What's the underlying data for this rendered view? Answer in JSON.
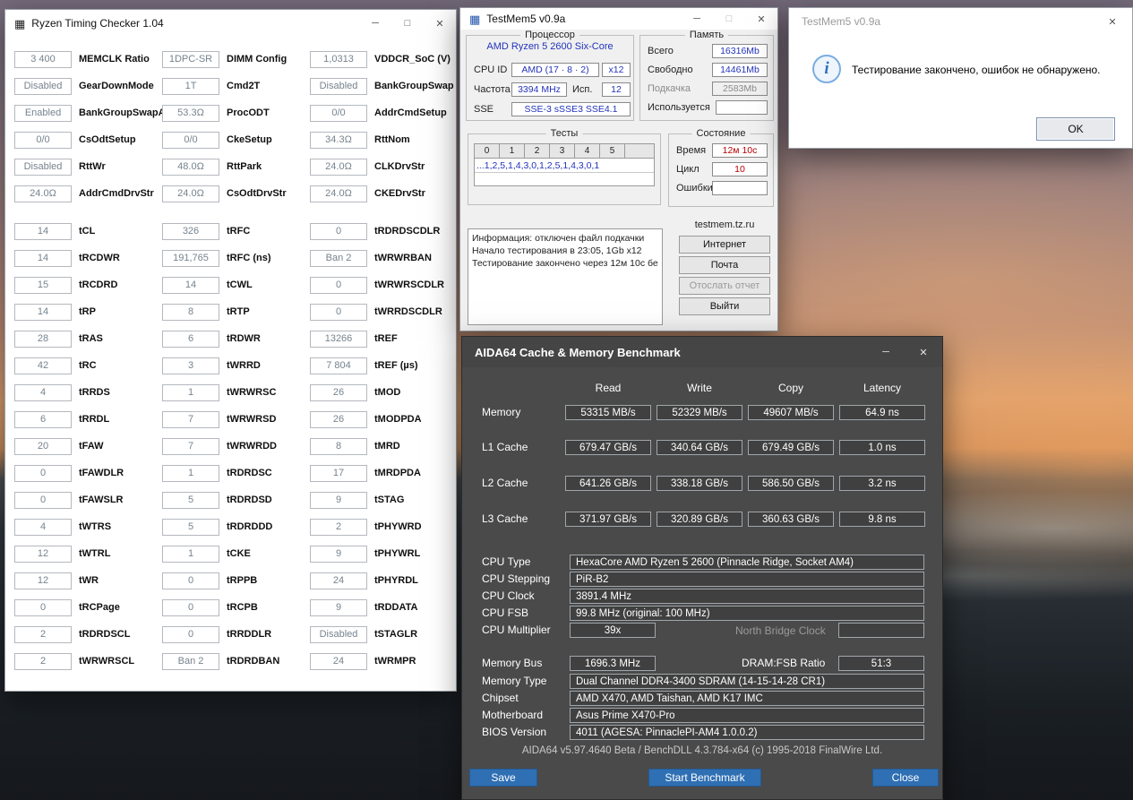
{
  "colors": {
    "rtc_value_text": "#76838e",
    "tm5_value_blue": "#2233bb",
    "tm5_alert_red": "#bb0000",
    "aida_window_bg": "#4a4a4a",
    "aida_button_blue": "#2f6fb3"
  },
  "window_controls": {
    "minimize": "─",
    "maximize": "□",
    "close": "✕"
  },
  "rtc": {
    "title": "Ryzen Timing Checker 1.04",
    "top": [
      {
        "v": "3 400",
        "l": "MEMCLK Ratio"
      },
      {
        "v": "1DPC-SR",
        "l": "DIMM Config"
      },
      {
        "v": "1,0313",
        "l": "VDDCR_SoC (V)"
      },
      {
        "v": "Disabled",
        "l": "GearDownMode"
      },
      {
        "v": "1T",
        "l": "Cmd2T"
      },
      {
        "v": "Disabled",
        "l": "BankGroupSwap"
      },
      {
        "v": "Enabled",
        "l": "BankGroupSwapAlt"
      },
      {
        "v": "53.3Ω",
        "l": "ProcODT"
      },
      {
        "v": "0/0",
        "l": "AddrCmdSetup"
      },
      {
        "v": "0/0",
        "l": "CsOdtSetup"
      },
      {
        "v": "0/0",
        "l": "CkeSetup"
      },
      {
        "v": "34.3Ω",
        "l": "RttNom"
      },
      {
        "v": "Disabled",
        "l": "RttWr"
      },
      {
        "v": "48.0Ω",
        "l": "RttPark"
      },
      {
        "v": "24.0Ω",
        "l": "CLKDrvStr"
      },
      {
        "v": "24.0Ω",
        "l": "AddrCmdDrvStr"
      },
      {
        "v": "24.0Ω",
        "l": "CsOdtDrvStr"
      },
      {
        "v": "24.0Ω",
        "l": "CKEDrvStr"
      }
    ],
    "main": [
      {
        "v": "14",
        "l": "tCL"
      },
      {
        "v": "326",
        "l": "tRFC"
      },
      {
        "v": "0",
        "l": "tRDRDSCDLR"
      },
      {
        "v": "14",
        "l": "tRCDWR"
      },
      {
        "v": "191,765",
        "l": "tRFC (ns)"
      },
      {
        "v": "Ban 2",
        "l": "tWRWRBAN"
      },
      {
        "v": "15",
        "l": "tRCDRD"
      },
      {
        "v": "14",
        "l": "tCWL"
      },
      {
        "v": "0",
        "l": "tWRWRSCDLR"
      },
      {
        "v": "14",
        "l": "tRP"
      },
      {
        "v": "8",
        "l": "tRTP"
      },
      {
        "v": "0",
        "l": "tWRRDSCDLR"
      },
      {
        "v": "28",
        "l": "tRAS"
      },
      {
        "v": "6",
        "l": "tRDWR"
      },
      {
        "v": "13266",
        "l": "tREF"
      },
      {
        "v": "42",
        "l": "tRC"
      },
      {
        "v": "3",
        "l": "tWRRD"
      },
      {
        "v": "7 804",
        "l": "tREF (µs)"
      },
      {
        "v": "4",
        "l": "tRRDS"
      },
      {
        "v": "1",
        "l": "tWRWRSC"
      },
      {
        "v": "26",
        "l": "tMOD"
      },
      {
        "v": "6",
        "l": "tRRDL"
      },
      {
        "v": "7",
        "l": "tWRWRSD"
      },
      {
        "v": "26",
        "l": "tMODPDA"
      },
      {
        "v": "20",
        "l": "tFAW"
      },
      {
        "v": "7",
        "l": "tWRWRDD"
      },
      {
        "v": "8",
        "l": "tMRD"
      },
      {
        "v": "0",
        "l": "tFAWDLR"
      },
      {
        "v": "1",
        "l": "tRDRDSC"
      },
      {
        "v": "17",
        "l": "tMRDPDA"
      },
      {
        "v": "0",
        "l": "tFAWSLR"
      },
      {
        "v": "5",
        "l": "tRDRDSD"
      },
      {
        "v": "9",
        "l": "tSTAG"
      },
      {
        "v": "4",
        "l": "tWTRS"
      },
      {
        "v": "5",
        "l": "tRDRDDD"
      },
      {
        "v": "2",
        "l": "tPHYWRD"
      },
      {
        "v": "12",
        "l": "tWTRL"
      },
      {
        "v": "1",
        "l": "tCKE"
      },
      {
        "v": "9",
        "l": "tPHYWRL"
      },
      {
        "v": "12",
        "l": "tWR"
      },
      {
        "v": "0",
        "l": "tRPPB"
      },
      {
        "v": "24",
        "l": "tPHYRDL"
      },
      {
        "v": "0",
        "l": "tRCPage"
      },
      {
        "v": "0",
        "l": "tRCPB"
      },
      {
        "v": "9",
        "l": "tRDDATA"
      },
      {
        "v": "2",
        "l": "tRDRDSCL"
      },
      {
        "v": "0",
        "l": "tRRDDLR"
      },
      {
        "v": "Disabled",
        "l": "tSTAGLR"
      },
      {
        "v": "2",
        "l": "tWRWRSCL"
      },
      {
        "v": "Ban 2",
        "l": "tRDRDBAN"
      },
      {
        "v": "24",
        "l": "tWRMPR"
      }
    ]
  },
  "tm5": {
    "title": "TestMem5 v0.9a",
    "cpu": {
      "caption": "Процессор",
      "name": "AMD Ryzen 5 2600 Six-Core",
      "cpuid_label": "CPU ID",
      "cpuid_value": "AMD  (17 · 8 · 2)",
      "cpuid_x": "x12",
      "freq_label": "Частота",
      "freq_value": "3394 MHz",
      "usage_label": "Исп.",
      "usage_value": "12",
      "sse_label": "SSE",
      "sse_value": "SSE-3 sSSE3 SSE4.1"
    },
    "memory": {
      "caption": "Память",
      "rows": [
        {
          "label": "Всего",
          "value": "16316Mb"
        },
        {
          "label": "Свободно",
          "value": "14461Mb"
        },
        {
          "label": "Подкачка",
          "value": "2583Mb"
        },
        {
          "label": "Используется",
          "value": ""
        }
      ]
    },
    "tests": {
      "caption": "Тесты",
      "columns": [
        "0",
        "1",
        "2",
        "3",
        "4",
        "5"
      ],
      "sequence": "...1,2,5,1,4,3,0,1,2,5,1,4,3,0,1"
    },
    "state": {
      "caption": "Состояние",
      "rows": [
        {
          "label": "Время",
          "value": "12м 10с"
        },
        {
          "label": "Цикл",
          "value": "10"
        },
        {
          "label": "Ошибки",
          "value": ""
        }
      ]
    },
    "info": [
      "Информация: отключен файл подкачки",
      "Начало тестирования в 23:05, 1Gb x12",
      "Тестирование закончено через 12м 10с бе"
    ],
    "site": "testmem.tz.ru",
    "buttons": [
      {
        "label": "Интернет",
        "enabled": true
      },
      {
        "label": "Почта",
        "enabled": true
      },
      {
        "label": "Отослать отчет",
        "enabled": false
      },
      {
        "label": "Выйти",
        "enabled": true
      }
    ]
  },
  "tm5_dialog": {
    "title": "TestMem5 v0.9a",
    "message": "Тестирование закончено, ошибок не обнаружено.",
    "ok_label": "OK"
  },
  "aida": {
    "title": "AIDA64 Cache & Memory Benchmark",
    "headers": [
      "Read",
      "Write",
      "Copy",
      "Latency"
    ],
    "bench": [
      {
        "label": "Memory",
        "read": "53315 MB/s",
        "write": "52329 MB/s",
        "copy": "49607 MB/s",
        "latency": "64.9 ns"
      },
      {
        "label": "L1 Cache",
        "read": "679.47 GB/s",
        "write": "340.64 GB/s",
        "copy": "679.49 GB/s",
        "latency": "1.0 ns"
      },
      {
        "label": "L2 Cache",
        "read": "641.26 GB/s",
        "write": "338.18 GB/s",
        "copy": "586.50 GB/s",
        "latency": "3.2 ns"
      },
      {
        "label": "L3 Cache",
        "read": "371.97 GB/s",
        "write": "320.89 GB/s",
        "copy": "360.63 GB/s",
        "latency": "9.8 ns"
      }
    ],
    "info": [
      {
        "label": "CPU Type",
        "value": "HexaCore AMD Ryzen 5 2600  (Pinnacle Ridge, Socket AM4)"
      },
      {
        "label": "CPU Stepping",
        "value": "PiR-B2"
      },
      {
        "label": "CPU Clock",
        "value": "3891.4 MHz"
      },
      {
        "label": "CPU FSB",
        "value": "99.8 MHz  (original: 100 MHz)"
      }
    ],
    "multiplier": {
      "label": "CPU Multiplier",
      "value": "39x",
      "ghost": "North Bridge Clock",
      "empty": ""
    },
    "membus": {
      "label": "Memory Bus",
      "value": "1696.3 MHz",
      "ratio_label": "DRAM:FSB Ratio",
      "ratio_value": "51:3"
    },
    "info2": [
      {
        "label": "Memory Type",
        "value": "Dual Channel DDR4-3400 SDRAM  (14-15-14-28 CR1)"
      },
      {
        "label": "Chipset",
        "value": "AMD X470, AMD Taishan, AMD K17 IMC"
      },
      {
        "label": "Motherboard",
        "value": "Asus Prime X470-Pro"
      },
      {
        "label": "BIOS Version",
        "value": "4011  (AGESA: PinnaclePI-AM4 1.0.0.2)"
      }
    ],
    "footer": "AIDA64 v5.97.4640 Beta / BenchDLL 4.3.784-x64  (c) 1995-2018 FinalWire Ltd.",
    "buttons": {
      "save": "Save",
      "start": "Start Benchmark",
      "close": "Close"
    }
  }
}
